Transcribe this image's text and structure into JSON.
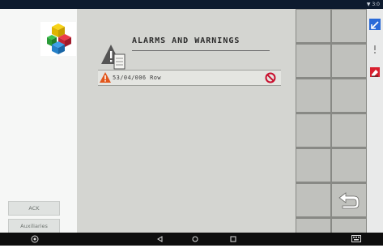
{
  "status_bar": {
    "text": "▼ 3:0"
  },
  "left_panel": {
    "ack_label": "ACK",
    "auxiliaries_label": "Auxiliaries"
  },
  "main": {
    "title": "ALARMS AND WARNINGS",
    "alarms": [
      {
        "text": "53/04/006 Row"
      }
    ]
  },
  "colors": {
    "warning": "#e2571c",
    "cancel": "#c8102e",
    "arrow_blue": "#2a6ad8"
  },
  "icons": [
    "logo-cubes",
    "alarm-doc-icon",
    "warning-icon",
    "cancel-icon",
    "back-arrow-icon",
    "minimize-icon",
    "info-icon",
    "eraser-icon",
    "home-icon",
    "back-nav-icon",
    "recent-icon",
    "keyboard-icon"
  ]
}
